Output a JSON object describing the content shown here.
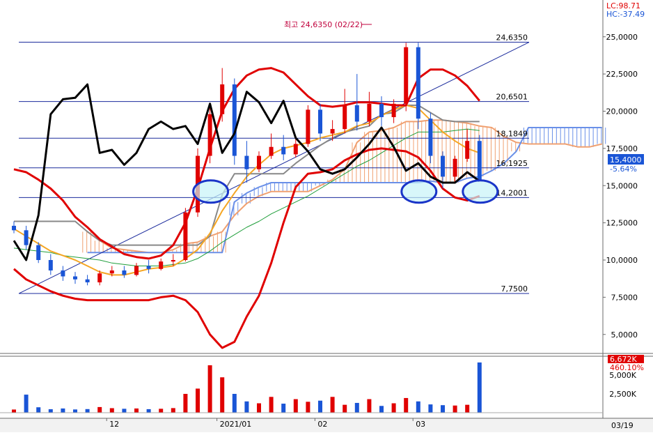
{
  "header": {
    "lc_label": "LC:98.71",
    "hc_label": "HC:-37.49"
  },
  "colors": {
    "rise": "#e00000",
    "fall": "#1a55d6",
    "bollinger": "#e00000",
    "psych_line": "#000000",
    "cloud_upper": "#f0a070",
    "cloud_lower": "#6a90e8",
    "ma_orange": "#f5a623",
    "ma_gray": "#888888",
    "ma_green": "#1f9e3a",
    "level_line": "#1a2a9c",
    "highlight_fill": "#c8f4f8",
    "highlight_stroke": "#1a35c8"
  },
  "chart_data": [
    {
      "type": "candlestick",
      "title": "",
      "ylim": [
        2.5,
        25.0
      ],
      "y_ticks": [
        "25,0000",
        "22,5000",
        "20,0000",
        "17,5000",
        "15,0000",
        "12,5000",
        "10,0000",
        "7,5000",
        "5,0000"
      ],
      "x_ticks": [
        "12",
        "2021/01",
        "02",
        "03"
      ],
      "date_badge": "03/19",
      "last_price_label": "15,4000",
      "last_change_label": "-5.64%",
      "level_lines": [
        {
          "label": "24,6350",
          "value": 24.635
        },
        {
          "label": "20,6501",
          "value": 20.6501
        },
        {
          "label": "18,1849",
          "value": 18.1849
        },
        {
          "label": "16,1925",
          "value": 16.1925
        },
        {
          "label": "14,2001",
          "value": 14.2001
        },
        {
          "label": "7,7500",
          "value": 7.75
        }
      ],
      "annotation": "최고 24,6350 (02/22)",
      "trend_line": {
        "from": 7.75,
        "to": 24.635
      },
      "bollinger_upper": [
        16.1,
        15.9,
        15.4,
        14.8,
        14.0,
        12.9,
        12.2,
        11.4,
        10.9,
        10.4,
        10.2,
        10.1,
        10.3,
        11.0,
        12.5,
        14.8,
        17.5,
        20.0,
        21.5,
        22.4,
        22.8,
        22.9,
        22.6,
        21.8,
        21.0,
        20.4,
        20.3,
        20.4,
        20.6,
        20.6,
        20.5,
        20.4,
        20.4,
        22.2,
        22.8,
        22.8,
        22.4,
        21.7,
        20.7
      ],
      "bollinger_lower": [
        9.4,
        8.7,
        8.3,
        7.9,
        7.6,
        7.4,
        7.3,
        7.3,
        7.3,
        7.3,
        7.3,
        7.3,
        7.5,
        7.6,
        7.3,
        6.5,
        5.0,
        4.1,
        4.5,
        6.2,
        7.6,
        9.8,
        12.5,
        14.9,
        15.8,
        15.9,
        16.1,
        16.7,
        17.1,
        17.4,
        17.5,
        17.4,
        17.3,
        16.9,
        16.0,
        14.8,
        14.2,
        14.0,
        14.3
      ],
      "psychological_line": [
        11.3,
        10.0,
        13.0,
        19.8,
        20.8,
        20.9,
        21.8,
        17.2,
        17.4,
        16.4,
        17.2,
        18.8,
        19.3,
        18.8,
        19.0,
        17.8,
        20.5,
        17.2,
        18.5,
        21.3,
        20.6,
        19.2,
        20.7,
        18.2,
        17.3,
        16.1,
        15.8,
        16.1,
        16.9,
        17.8,
        18.9,
        17.6,
        16.0,
        16.5,
        15.6,
        15.2,
        15.2,
        15.9,
        15.3
      ],
      "candles": [
        {
          "o": 12.3,
          "h": 12.6,
          "l": 11.8,
          "c": 12.0
        },
        {
          "o": 12.0,
          "h": 12.3,
          "l": 10.7,
          "c": 11.0
        },
        {
          "o": 11.0,
          "h": 11.2,
          "l": 9.8,
          "c": 10.0
        },
        {
          "o": 10.0,
          "h": 10.4,
          "l": 9.0,
          "c": 9.3
        },
        {
          "o": 9.3,
          "h": 9.6,
          "l": 8.6,
          "c": 8.9
        },
        {
          "o": 8.9,
          "h": 9.2,
          "l": 8.4,
          "c": 8.7
        },
        {
          "o": 8.7,
          "h": 9.0,
          "l": 8.3,
          "c": 8.5
        },
        {
          "o": 8.5,
          "h": 9.3,
          "l": 8.3,
          "c": 9.1
        },
        {
          "o": 9.1,
          "h": 9.6,
          "l": 8.9,
          "c": 9.3
        },
        {
          "o": 9.3,
          "h": 9.6,
          "l": 8.8,
          "c": 9.0
        },
        {
          "o": 9.0,
          "h": 9.8,
          "l": 8.9,
          "c": 9.6
        },
        {
          "o": 9.6,
          "h": 10.0,
          "l": 9.1,
          "c": 9.4
        },
        {
          "o": 9.4,
          "h": 10.1,
          "l": 9.3,
          "c": 9.9
        },
        {
          "o": 9.9,
          "h": 10.4,
          "l": 9.6,
          "c": 10.0
        },
        {
          "o": 10.0,
          "h": 13.5,
          "l": 9.9,
          "c": 13.2
        },
        {
          "o": 13.2,
          "h": 17.5,
          "l": 12.9,
          "c": 17.0
        },
        {
          "o": 17.0,
          "h": 20.5,
          "l": 16.5,
          "c": 19.8
        },
        {
          "o": 19.8,
          "h": 22.9,
          "l": 19.3,
          "c": 21.8
        },
        {
          "o": 21.8,
          "h": 22.2,
          "l": 16.4,
          "c": 17.0
        },
        {
          "o": 17.0,
          "h": 18.0,
          "l": 15.2,
          "c": 16.1
        },
        {
          "o": 16.1,
          "h": 17.3,
          "l": 15.9,
          "c": 17.0
        },
        {
          "o": 17.0,
          "h": 18.5,
          "l": 16.8,
          "c": 17.6
        },
        {
          "o": 17.6,
          "h": 18.4,
          "l": 16.7,
          "c": 17.1
        },
        {
          "o": 17.1,
          "h": 18.3,
          "l": 16.9,
          "c": 17.8
        },
        {
          "o": 17.8,
          "h": 20.4,
          "l": 17.6,
          "c": 20.1
        },
        {
          "o": 20.1,
          "h": 20.5,
          "l": 18.0,
          "c": 18.5
        },
        {
          "o": 18.5,
          "h": 19.4,
          "l": 18.0,
          "c": 18.8
        },
        {
          "o": 18.8,
          "h": 21.5,
          "l": 18.5,
          "c": 20.4
        },
        {
          "o": 20.4,
          "h": 22.5,
          "l": 18.7,
          "c": 19.3
        },
        {
          "o": 19.3,
          "h": 21.3,
          "l": 19.0,
          "c": 20.5
        },
        {
          "o": 20.5,
          "h": 21.0,
          "l": 19.0,
          "c": 19.6
        },
        {
          "o": 19.6,
          "h": 20.8,
          "l": 19.2,
          "c": 20.5
        },
        {
          "o": 20.5,
          "h": 24.6,
          "l": 20.0,
          "c": 24.3
        },
        {
          "o": 24.3,
          "h": 24.6,
          "l": 18.8,
          "c": 19.5
        },
        {
          "o": 19.5,
          "h": 19.9,
          "l": 16.5,
          "c": 17.0
        },
        {
          "o": 17.0,
          "h": 17.3,
          "l": 14.8,
          "c": 15.6
        },
        {
          "o": 15.6,
          "h": 17.0,
          "l": 15.2,
          "c": 16.8
        },
        {
          "o": 16.8,
          "h": 18.8,
          "l": 16.6,
          "c": 18.0
        },
        {
          "o": 18.0,
          "h": 18.4,
          "l": 15.3,
          "c": 15.4
        }
      ],
      "cloud_span_a": [
        null,
        null,
        null,
        null,
        null,
        null,
        11.9,
        11.3,
        10.8,
        10.7,
        10.6,
        10.5,
        10.5,
        10.7,
        11.1,
        11.2,
        11.6,
        11.9,
        13.0,
        13.8,
        14.3,
        14.6,
        14.6,
        14.6,
        14.6,
        15.0,
        15.4,
        16.1,
        17.9,
        18.6,
        18.7,
        18.9,
        19.3,
        19.3,
        19.4,
        19.4,
        19.3,
        19.2,
        19.0,
        18.9,
        18.3,
        17.9,
        17.8,
        17.8,
        17.8,
        17.8,
        17.6,
        17.6,
        17.8
      ],
      "cloud_span_b": [
        null,
        null,
        null,
        null,
        null,
        null,
        10.5,
        10.5,
        10.5,
        10.5,
        10.5,
        10.5,
        10.5,
        10.5,
        10.5,
        10.5,
        10.5,
        10.5,
        13.9,
        14.5,
        14.9,
        15.2,
        15.2,
        15.2,
        15.2,
        15.2,
        15.2,
        15.2,
        15.2,
        15.2,
        15.2,
        15.2,
        15.2,
        15.2,
        15.3,
        15.2,
        15.2,
        15.5,
        15.6,
        16.0,
        16.5,
        17.3,
        18.9,
        18.9,
        18.9,
        18.9,
        18.9,
        18.9,
        18.9
      ],
      "ma_orange": [
        12.1,
        11.6,
        11.1,
        10.6,
        10.3,
        10.0,
        9.6,
        9.2,
        9.0,
        9.0,
        9.2,
        9.4,
        9.5,
        9.6,
        10.1,
        10.7,
        11.8,
        13.3,
        14.5,
        15.6,
        16.4,
        17.1,
        17.5,
        17.7,
        17.9,
        18.2,
        18.4,
        18.6,
        19.0,
        19.2,
        19.7,
        20.1,
        20.4,
        20.2,
        19.4,
        18.6,
        18.0,
        17.5,
        17.2
      ],
      "ma_gray": [
        12.6,
        12.6,
        12.6,
        12.6,
        12.6,
        12.6,
        11.9,
        11.3,
        11.0,
        11.0,
        11.0,
        11.0,
        11.0,
        11.0,
        11.0,
        11.0,
        11.6,
        14.4,
        15.8,
        15.8,
        15.8,
        15.8,
        15.8,
        16.5,
        17.1,
        17.7,
        18.2,
        18.6,
        18.8,
        19.0,
        19.8,
        19.9,
        20.4,
        20.4,
        19.9,
        19.4,
        19.3,
        19.3,
        19.3
      ],
      "ma_green": [
        10.8,
        10.7,
        10.6,
        10.5,
        10.3,
        10.2,
        10.1,
        10.0,
        9.8,
        9.7,
        9.6,
        9.6,
        9.6,
        9.7,
        9.8,
        10.1,
        10.6,
        11.2,
        11.7,
        12.2,
        12.6,
        13.1,
        13.5,
        13.9,
        14.3,
        14.8,
        15.3,
        15.8,
        16.3,
        16.7,
        17.2,
        17.7,
        18.2,
        18.6,
        18.6,
        18.6,
        18.7,
        18.8,
        18.7
      ]
    },
    {
      "type": "bar",
      "title": "",
      "y_ticks": [
        "5,000K",
        "2,500K"
      ],
      "last_volume_label": "6,672K",
      "last_volume_change_label": "460.10%",
      "volumes": [
        420,
        2400,
        720,
        460,
        560,
        430,
        480,
        750,
        600,
        520,
        560,
        470,
        520,
        610,
        2500,
        3200,
        6300,
        4700,
        2500,
        1500,
        1250,
        2100,
        1200,
        1800,
        1450,
        1600,
        2100,
        1050,
        1300,
        1800,
        900,
        1250,
        1950,
        1500,
        1100,
        1000,
        950,
        1050,
        6672
      ]
    }
  ]
}
